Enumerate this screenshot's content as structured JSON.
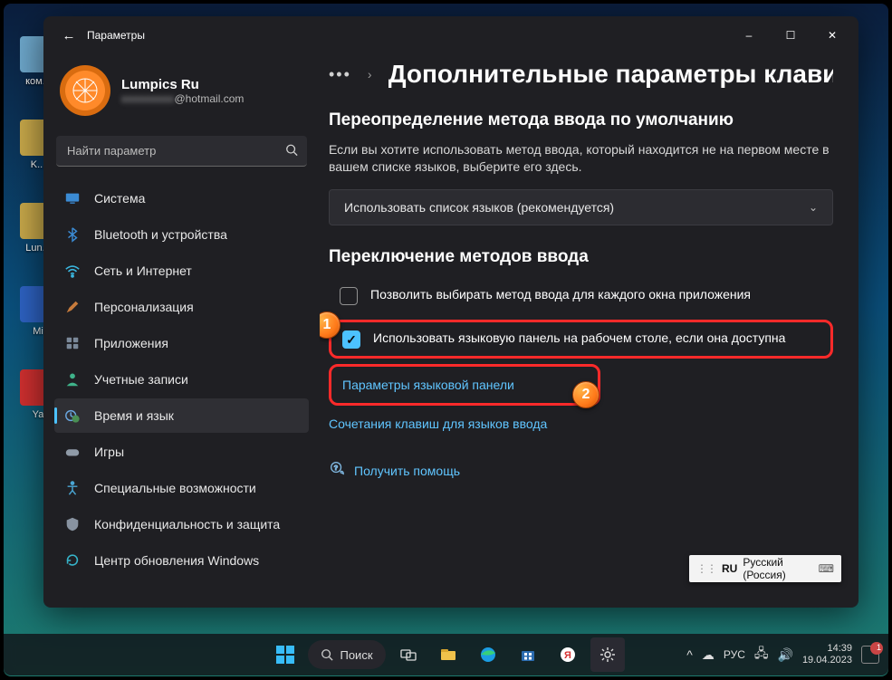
{
  "window": {
    "title": "Параметры",
    "minimize": "—",
    "maximize": "▢",
    "close": "✕"
  },
  "profile": {
    "name": "Lumpics Ru",
    "email_prefix": "xxxxxxxxx",
    "email_suffix": "@hotmail.com"
  },
  "search": {
    "placeholder": "Найти параметр"
  },
  "nav": {
    "system": "Система",
    "bluetooth": "Bluetooth и устройства",
    "network": "Сеть и Интернет",
    "personalization": "Персонализация",
    "apps": "Приложения",
    "accounts": "Учетные записи",
    "time": "Время и язык",
    "gaming": "Игры",
    "accessibility": "Специальные возможности",
    "privacy": "Конфиденциальность и защита",
    "update": "Центр обновления Windows"
  },
  "main": {
    "crumb_dots": "•••",
    "crumb_chev": "›",
    "title": "Дополнительные параметры клавиа",
    "section1_title": "Переопределение метода ввода по умолчанию",
    "section1_desc": "Если вы хотите использовать метод ввода, который находится не на первом месте в вашем списке языков, выберите его здесь.",
    "dropdown_value": "Использовать список языков (рекомендуется)",
    "section2_title": "Переключение методов ввода",
    "chk1": "Позволить выбирать метод ввода для каждого окна приложения",
    "chk2": "Использовать языковую панель на рабочем столе, если она доступна",
    "link1": "Параметры языковой панели",
    "link2": "Сочетания клавиш для языков ввода",
    "help": "Получить помощь"
  },
  "annotations": {
    "marker1": "1",
    "marker2": "2"
  },
  "lang_float": {
    "code": "RU",
    "name": "Русский (Россия)"
  },
  "desktop_icons": {
    "i0": "ком...",
    "i1": "K...",
    "i2": "",
    "i3": "Lun...",
    "i4": "",
    "i5": "Mi",
    "i6": "",
    "i7": "Ya"
  },
  "taskbar": {
    "search": "Поиск",
    "lang": "РУС",
    "time": "14:39",
    "date": "19.04.2023",
    "notif_count": "1"
  }
}
